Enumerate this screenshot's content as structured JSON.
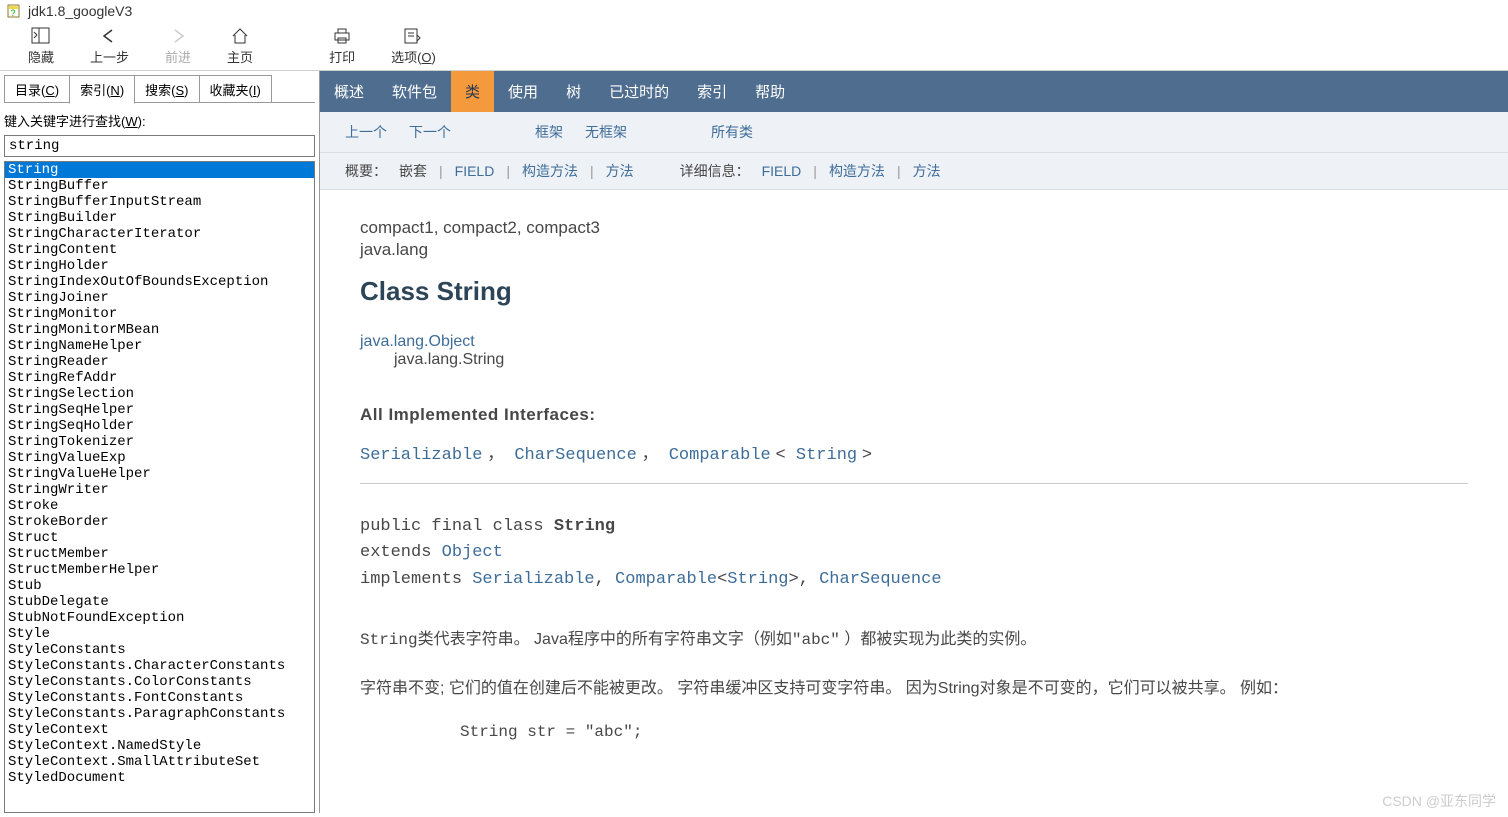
{
  "window": {
    "title": "jdk1.8_googleV3"
  },
  "toolbar": {
    "hide": "隐藏",
    "back": "上一步",
    "forward": "前进",
    "home": "主页",
    "print": "打印",
    "options": "选项(O)"
  },
  "sidebar": {
    "tabs": {
      "contents": "目录(C)",
      "index": "索引(N)",
      "search": "搜索(S)",
      "favorites": "收藏夹(I)"
    },
    "search_label": "键入关键字进行查找(W):",
    "search_value": "string",
    "results": [
      "String",
      "StringBuffer",
      "StringBufferInputStream",
      "StringBuilder",
      "StringCharacterIterator",
      "StringContent",
      "StringHolder",
      "StringIndexOutOfBoundsException",
      "StringJoiner",
      "StringMonitor",
      "StringMonitorMBean",
      "StringNameHelper",
      "StringReader",
      "StringRefAddr",
      "StringSelection",
      "StringSeqHelper",
      "StringSeqHolder",
      "StringTokenizer",
      "StringValueExp",
      "StringValueHelper",
      "StringWriter",
      "Stroke",
      "StrokeBorder",
      "Struct",
      "StructMember",
      "StructMemberHelper",
      "Stub",
      "StubDelegate",
      "StubNotFoundException",
      "Style",
      "StyleConstants",
      "StyleConstants.CharacterConstants",
      "StyleConstants.ColorConstants",
      "StyleConstants.FontConstants",
      "StyleConstants.ParagraphConstants",
      "StyleContext",
      "StyleContext.NamedStyle",
      "StyleContext.SmallAttributeSet",
      "StyledDocument"
    ],
    "selected_index": 0
  },
  "content": {
    "nav": {
      "overview": "概述",
      "packages": "软件包",
      "class": "类",
      "use": "使用",
      "tree": "树",
      "deprecated": "已过时的",
      "index": "索引",
      "help": "帮助"
    },
    "subnav": {
      "prev": "上一个",
      "next": "下一个",
      "frames": "框架",
      "noframes": "无框架",
      "allclasses": "所有类"
    },
    "summary_row": {
      "summary_lbl": "概要：",
      "nested": "嵌套",
      "field": "FIELD",
      "constr": "构造方法",
      "method": "方法",
      "detail_lbl": "详细信息：",
      "field2": "FIELD",
      "constr2": "构造方法",
      "method2": "方法"
    },
    "compact_line": "compact1, compact2, compact3",
    "package_line": "java.lang",
    "class_title": "Class String",
    "hierarchy": {
      "root": "java.lang.Object",
      "leaf": "java.lang.String"
    },
    "interfaces_hdr": "All Implemented Interfaces:",
    "interfaces": {
      "a": "Serializable",
      "b": "CharSequence",
      "c": "Comparable",
      "c_param_open": "<",
      "c_param": "String",
      "c_param_close": ">"
    },
    "signature": {
      "l1a": "public final class ",
      "l1b": "String",
      "l2a": "extends ",
      "l2b": "Object",
      "l3a": "implements ",
      "l3b": "Serializable",
      "l3c": ", ",
      "l3d": "Comparable",
      "l3e": "<",
      "l3f": "String",
      "l3g": ">, ",
      "l3h": "CharSequence"
    },
    "para1a": "String",
    "para1b": "类代表字符串。 Java程序中的所有字符串文字（例如",
    "para1c": "\"abc\"",
    "para1d": " ）都被实现为此类的实例。",
    "para2": "字符串不变; 它们的值在创建后不能被更改。 字符串缓冲区支持可变字符串。 因为String对象是不可变的，它们可以被共享。 例如：",
    "codeblock": "String str = \"abc\";"
  },
  "watermark": "CSDN @亚东同学"
}
